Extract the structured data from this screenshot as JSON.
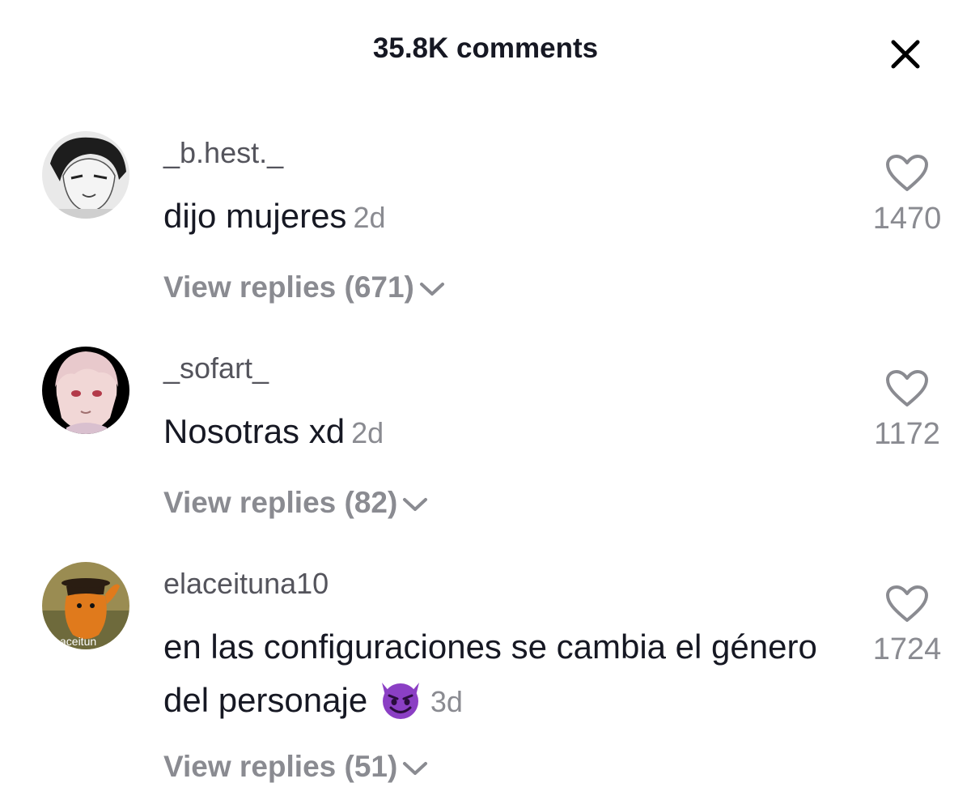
{
  "header": {
    "title": "35.8K comments",
    "close_icon": "close-icon"
  },
  "comments": [
    {
      "username": "_b.hest._",
      "text": "dijo mujeres",
      "time": "2d",
      "likes": "1470",
      "view_replies": "View replies (671)"
    },
    {
      "username": "_sofart_",
      "text": "Nosotras xd",
      "time": "2d",
      "likes": "1172",
      "view_replies": "View replies (82)"
    },
    {
      "username": "elaceituna10",
      "text": "en las configuraciones se cambia el género del personaje",
      "emoji": "smiling-imp-emoji",
      "time": "3d",
      "likes": "1724",
      "view_replies": "View replies (51)",
      "avatar_text": "aceitun"
    }
  ],
  "colors": {
    "primary_text": "#161823",
    "secondary_text": "#8a8b91",
    "username": "#54545c",
    "emoji_purple": "#8b3fc4"
  }
}
